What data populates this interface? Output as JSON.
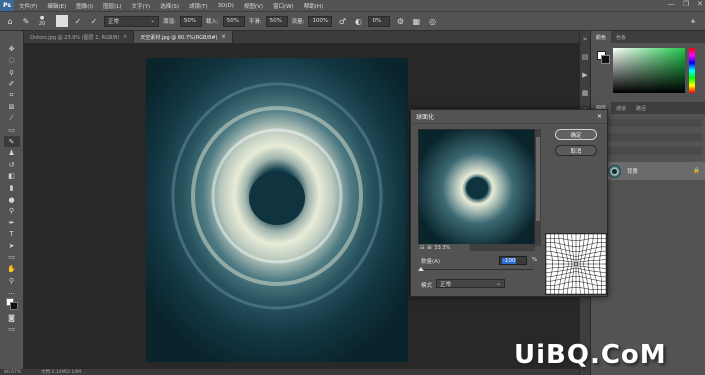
{
  "app": {
    "logo": "Ps"
  },
  "menu": [
    "文件(F)",
    "编辑(E)",
    "图像(I)",
    "图层(L)",
    "文字(Y)",
    "选择(S)",
    "滤镜(T)",
    "3D(D)",
    "视图(V)",
    "窗口(W)",
    "帮助(H)"
  ],
  "window_controls": {
    "minimize": "—",
    "maximize": "❐",
    "close": "✕"
  },
  "options": {
    "brush_size": "20",
    "mode_label": "模式:",
    "mode_value": "正常",
    "opacity_label": "不透明度:",
    "opacity_value": "100%",
    "flow_label": "流量:",
    "flow_value": "100%",
    "smooth_label": "平滑:",
    "smooth_value": "0%",
    "angle_value": "0°",
    "misc_label": "载入:",
    "misc_value": "50%",
    "misc2_label": "潮湿:",
    "misc2_value": "50%"
  },
  "tabs": [
    {
      "label": "Ontonl.jpg @ 23.9% (图层 1, RGB/8)",
      "active": false
    },
    {
      "label": "天空素材.jpg @ 80.7%(RGB/8#)",
      "active": true
    }
  ],
  "panels": {
    "color_tabs": [
      "颜色",
      "色板"
    ],
    "layer_tabs": [
      "图层",
      "通道",
      "路径"
    ],
    "layer_name": "背景",
    "lock_icon": "lock-icon"
  },
  "dialog": {
    "title": "球面化",
    "ok_label": "确定",
    "cancel_label": "取消",
    "zoom": "33.3%",
    "amount_label": "数量(A)",
    "amount_value": "-100",
    "amount_unit": "%",
    "amount_fraction": 0,
    "mode_label": "模式",
    "mode_value": "正常"
  },
  "status": {
    "zoom": "80.67%",
    "doc": "文档:2.14M/2.14M"
  },
  "watermark": "UiBQ.CoM",
  "colors": {
    "foreground": "#ffffff",
    "background": "#111111",
    "accent": "#2f6fd3"
  }
}
